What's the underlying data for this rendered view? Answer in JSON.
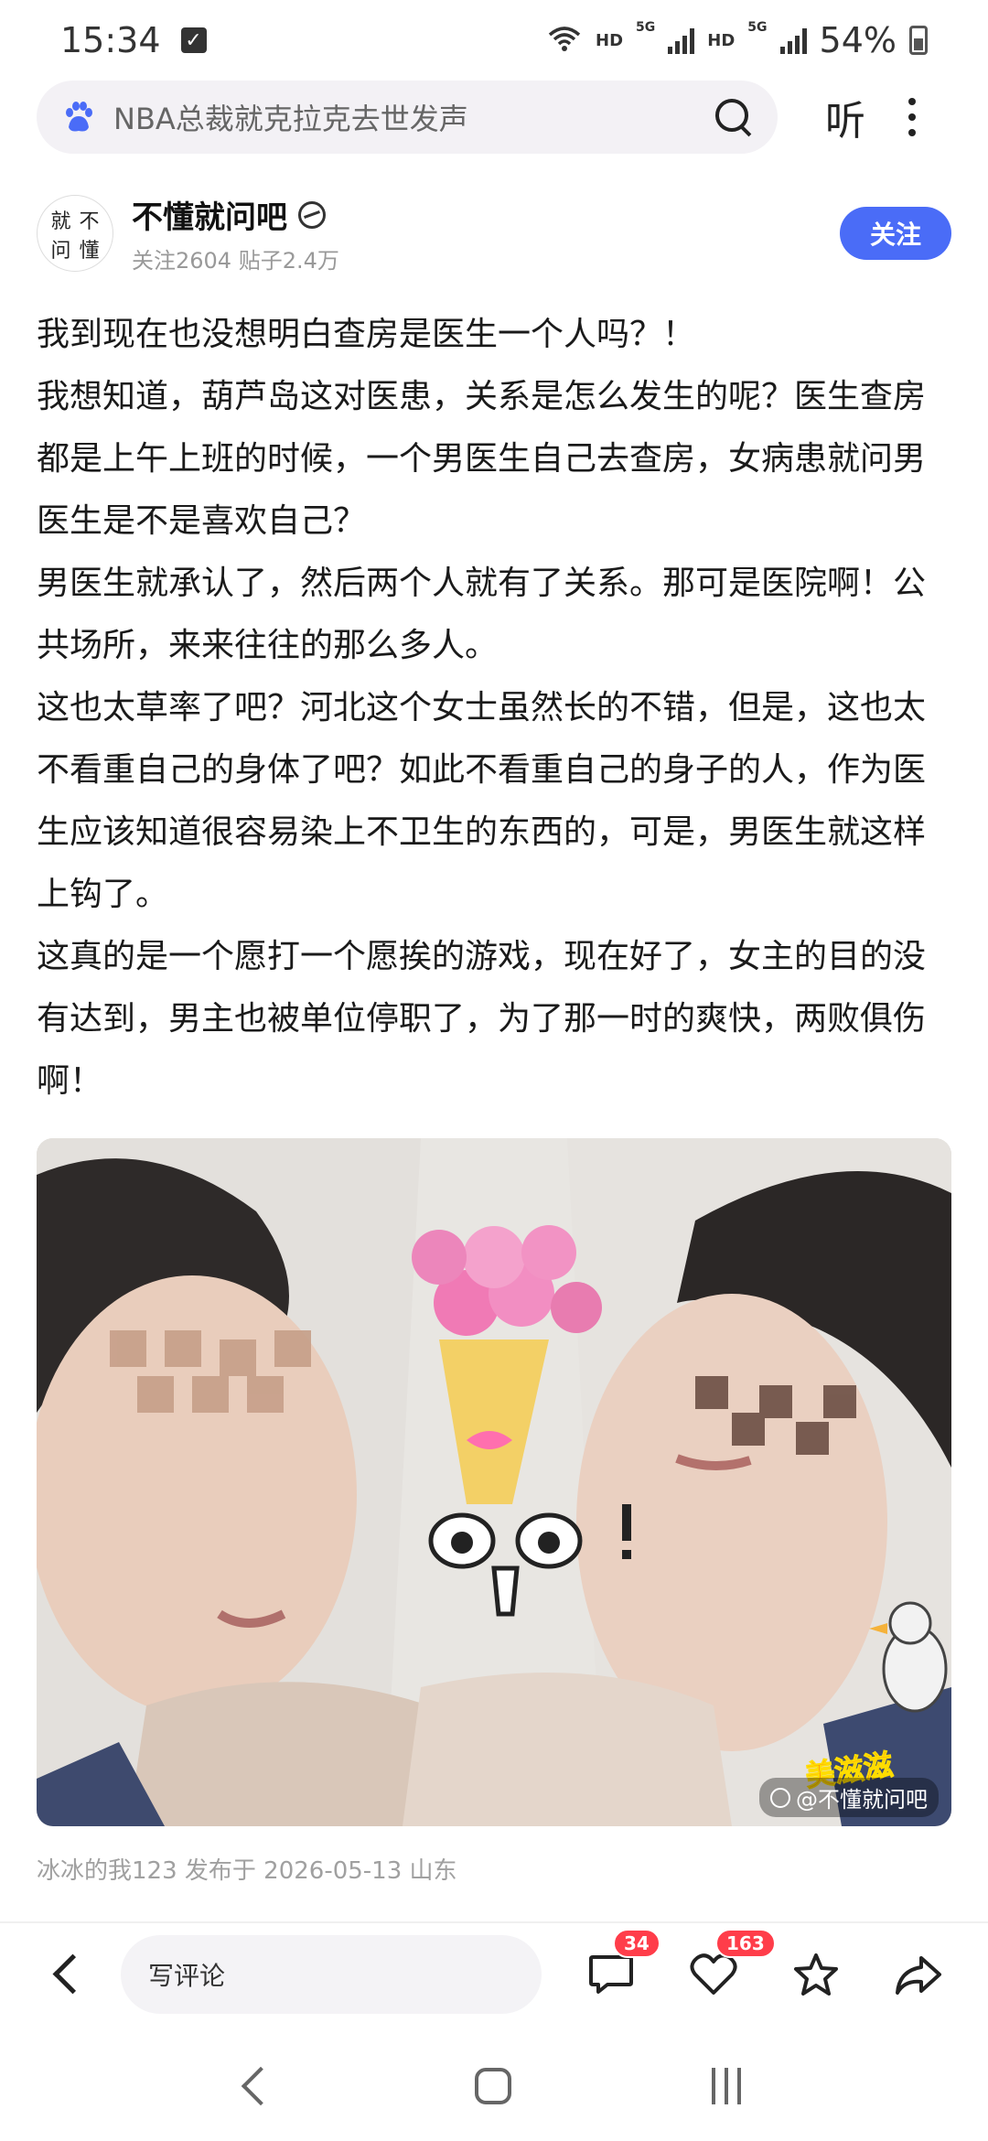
{
  "status_bar": {
    "time": "15:34",
    "battery_percent": "54%",
    "hd_label": "HD",
    "network_label": "5G"
  },
  "search": {
    "query": "NBA总裁就克拉克去世发声",
    "listen_label": "听"
  },
  "forum": {
    "name": "不懂就问吧",
    "stats": "关注2604 贴子2.4万",
    "follow_label": "关注",
    "avatar_chars": [
      "就",
      "不",
      "问",
      "懂"
    ]
  },
  "post": {
    "paragraphs": [
      "我到现在也没想明白查房是医生一个人吗？！",
      "我想知道，葫芦岛这对医患，关系是怎么发生的呢？医生查房都是上午上班的时候，一个男医生自己去查房，女病患就问男医生是不是喜欢自己？",
      "男医生就承认了，然后两个人就有了关系。那可是医院啊！公共场所，来来往往的那么多人。",
      "这也太草率了吧？河北这个女士虽然长的不错，但是，这也太不看重自己的身体了吧？如此不看重自己的身子的人，作为医生应该知道很容易染上不卫生的东西的，可是，男医生就这样上钩了。",
      "这真的是一个愿打一个愿挨的游戏，现在好了，女主的目的没有达到，男主也被单位停职了，为了那一时的爽快，两败俱伤啊！"
    ],
    "image_watermark": "@不懂就问吧",
    "image_sticker_text": "美滋滋",
    "meta": "冰冰的我123 发布于 2026-05-13 山东"
  },
  "action_bar": {
    "comment_placeholder": "写评论",
    "comment_count": "34",
    "like_count": "163"
  },
  "icons": {
    "search": "search-icon",
    "more": "more-icon",
    "back": "back-icon",
    "comment": "comment-icon",
    "like": "heart-icon",
    "favorite": "star-icon",
    "share": "share-icon"
  },
  "colors": {
    "accent": "#4a6cf7",
    "badge": "#ff3d4a"
  }
}
